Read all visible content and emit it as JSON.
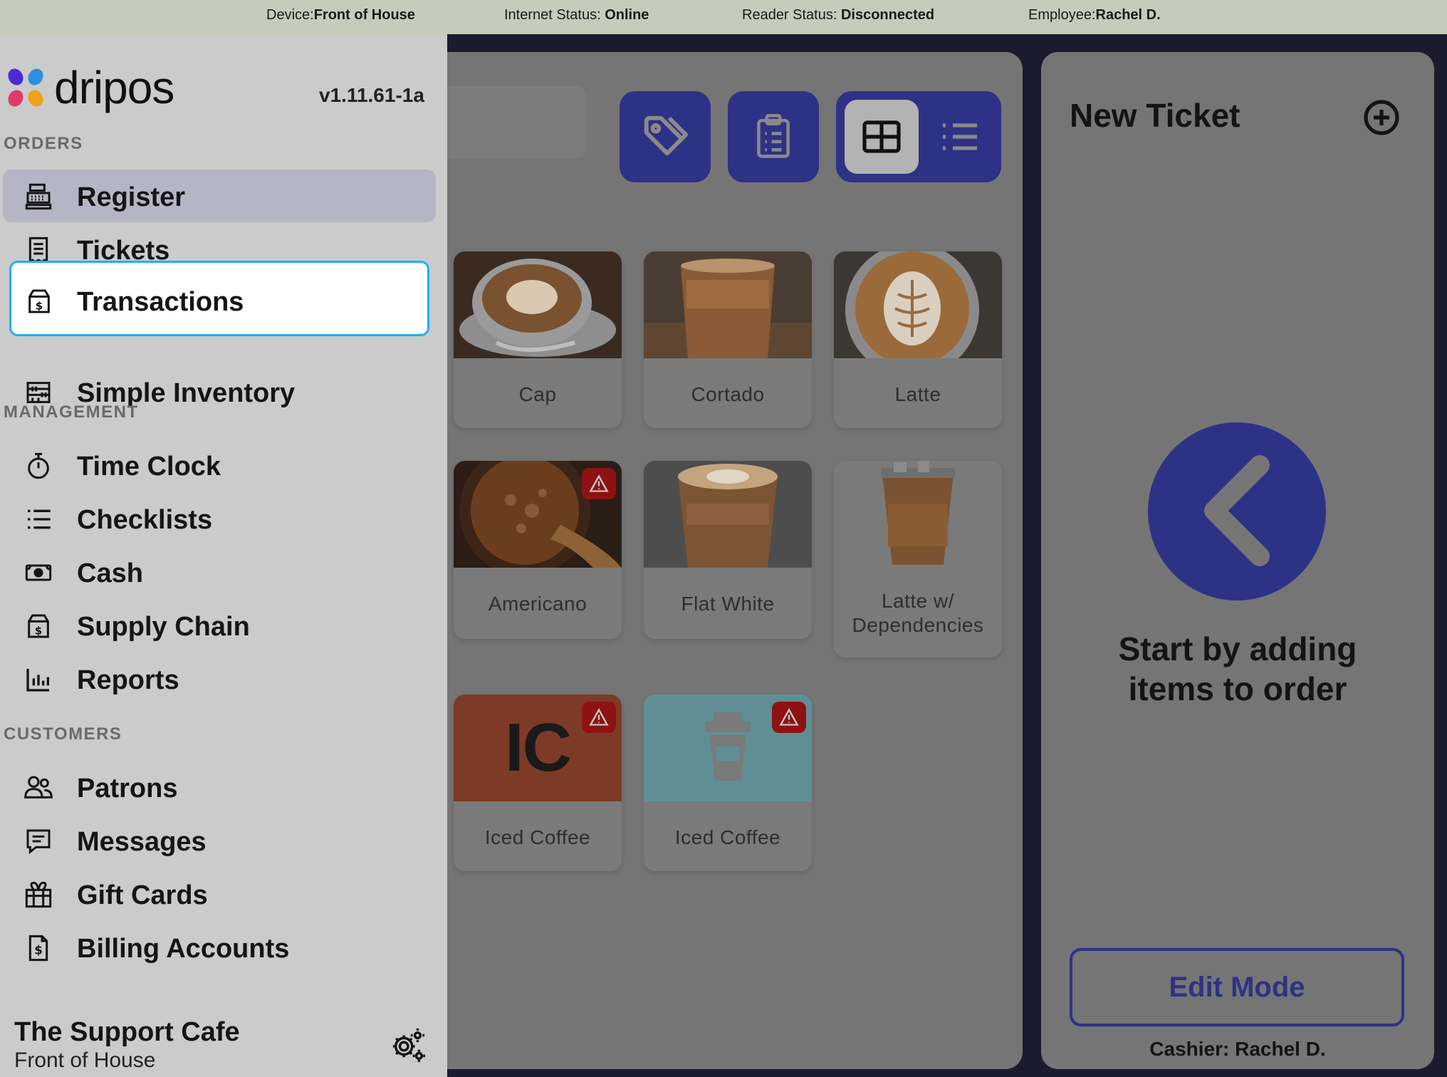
{
  "status_bar": {
    "device_label": "Device:",
    "device_value": "Front of House",
    "internet_label": "Internet Status: ",
    "internet_value": "Online",
    "reader_label": "Reader Status: ",
    "reader_value": "Disconnected",
    "employee_label": "Employee:",
    "employee_value": "Rachel D."
  },
  "sidebar": {
    "brand": "dripos",
    "version": "v1.11.61-1a",
    "sections": {
      "orders": "ORDERS",
      "management": "MANAGEMENT",
      "customers": "CUSTOMERS"
    },
    "items": {
      "register": "Register",
      "tickets": "Tickets",
      "transactions": "Transactions",
      "simple_inventory": "Simple Inventory",
      "time_clock": "Time Clock",
      "checklists": "Checklists",
      "cash": "Cash",
      "supply_chain": "Supply Chain",
      "reports": "Reports",
      "patrons": "Patrons",
      "messages": "Messages",
      "gift_cards": "Gift Cards",
      "billing_accounts": "Billing Accounts"
    },
    "footer": {
      "cafe_name": "The Support Cafe",
      "device": "Front of House"
    }
  },
  "products": {
    "cap": "Cap",
    "cortado": "Cortado",
    "latte": "Latte",
    "americano": "Americano",
    "flat_white": "Flat White",
    "latte_dependencies": "Latte w/ Dependencies",
    "iced_coffee_ic": "Iced Coffee",
    "ic_initials": "IC",
    "iced_coffee_cup": "Iced Coffee"
  },
  "ticket": {
    "title": "New Ticket",
    "empty_line1": "Start by adding",
    "empty_line2": "items to order",
    "edit_mode": "Edit Mode",
    "cashier": "Cashier: Rachel D."
  },
  "colors": {
    "accent": "#2d3286",
    "focus_ring": "#1bb2ef",
    "warning": "#8e1212"
  }
}
